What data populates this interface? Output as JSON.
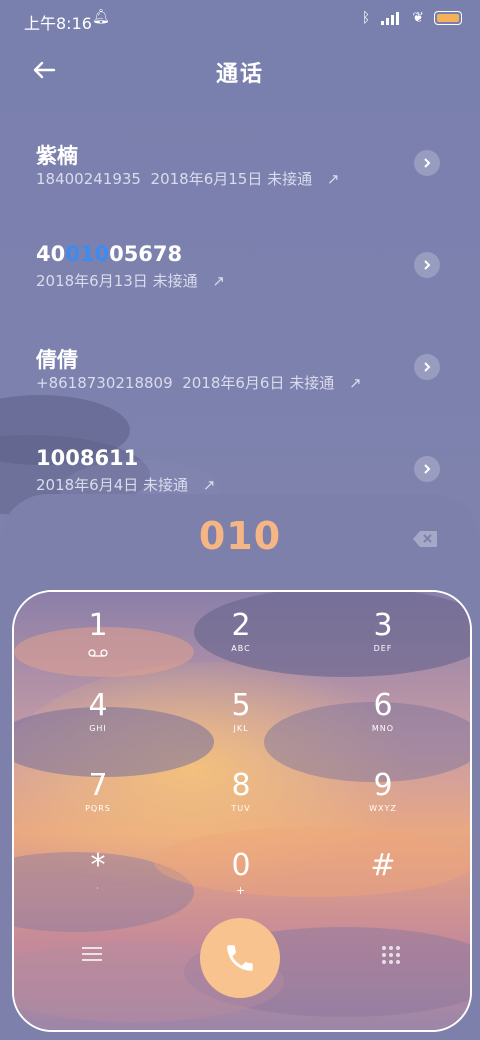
{
  "status": {
    "time": "上午8:16"
  },
  "header": {
    "title": "通话"
  },
  "calls": [
    {
      "name": "紫楠",
      "number": "18400241935",
      "date": "2018年6月15日",
      "status": "未接通"
    },
    {
      "name_pre": "40",
      "name_hl": "010",
      "name_post": "05678",
      "date": "2018年6月13日",
      "status": "未接通"
    },
    {
      "name": "倩倩",
      "number": "+8618730218809",
      "date": "2018年6月6日",
      "status": "未接通"
    },
    {
      "name": "1008611",
      "date": "2018年6月4日",
      "status": "未接通"
    }
  ],
  "dialer": {
    "entered": "010",
    "keys": [
      {
        "num": "1",
        "letters": ""
      },
      {
        "num": "2",
        "letters": "ABC"
      },
      {
        "num": "3",
        "letters": "DEF"
      },
      {
        "num": "4",
        "letters": "GHI"
      },
      {
        "num": "5",
        "letters": "JKL"
      },
      {
        "num": "6",
        "letters": "MNO"
      },
      {
        "num": "7",
        "letters": "PQRS"
      },
      {
        "num": "8",
        "letters": "TUV"
      },
      {
        "num": "9",
        "letters": "WXYZ"
      },
      {
        "num": "*",
        "letters": "·"
      },
      {
        "num": "0",
        "letters": "+"
      },
      {
        "num": "#",
        "letters": ""
      }
    ]
  },
  "colors": {
    "accent": "#f6b585",
    "call_button": "#f9c390",
    "highlight": "#3a8cf3",
    "panel": "#7d80ab"
  },
  "icons": [
    "back-arrow-icon",
    "chevron-right-icon",
    "outgoing-call-icon",
    "backspace-icon",
    "voicemail-icon",
    "menu-icon",
    "dialpad-icon",
    "phone-icon"
  ]
}
